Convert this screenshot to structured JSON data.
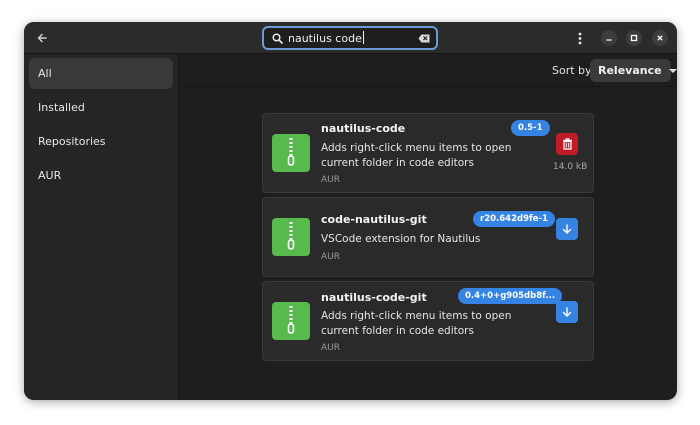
{
  "header": {
    "search_value": "nautilus code",
    "icons": {
      "back": "back-arrow-icon",
      "search": "search-icon",
      "clear": "clear-text-icon",
      "menu": "kebab-menu-icon",
      "minimize": "minimize-icon",
      "maximize": "maximize-icon",
      "close": "close-icon"
    }
  },
  "sidebar": {
    "items": [
      {
        "label": "All",
        "active": true
      },
      {
        "label": "Installed",
        "active": false
      },
      {
        "label": "Repositories",
        "active": false
      },
      {
        "label": "AUR",
        "active": false
      }
    ]
  },
  "sort": {
    "label": "Sort by",
    "selected": "Relevance"
  },
  "results": [
    {
      "name": "nautilus-code",
      "version": "0.5-1",
      "description": "Adds right-click menu items to open current folder in code editors",
      "repo": "AUR",
      "action": "remove",
      "action_icon": "trash-icon",
      "size": "14.0 kB"
    },
    {
      "name": "code-nautilus-git",
      "version": "r20.642d9fe-1",
      "description": "VSCode extension for Nautilus",
      "repo": "AUR",
      "action": "install",
      "action_icon": "download-icon"
    },
    {
      "name": "nautilus-code-git",
      "version": "0.4+0+g905db8f...",
      "description": "Adds right-click menu items to open current folder in code editors",
      "repo": "AUR",
      "action": "install",
      "action_icon": "download-icon"
    }
  ],
  "colors": {
    "accent": "#3584e4",
    "destructive": "#c01c28",
    "app_icon": "#58b94d"
  }
}
